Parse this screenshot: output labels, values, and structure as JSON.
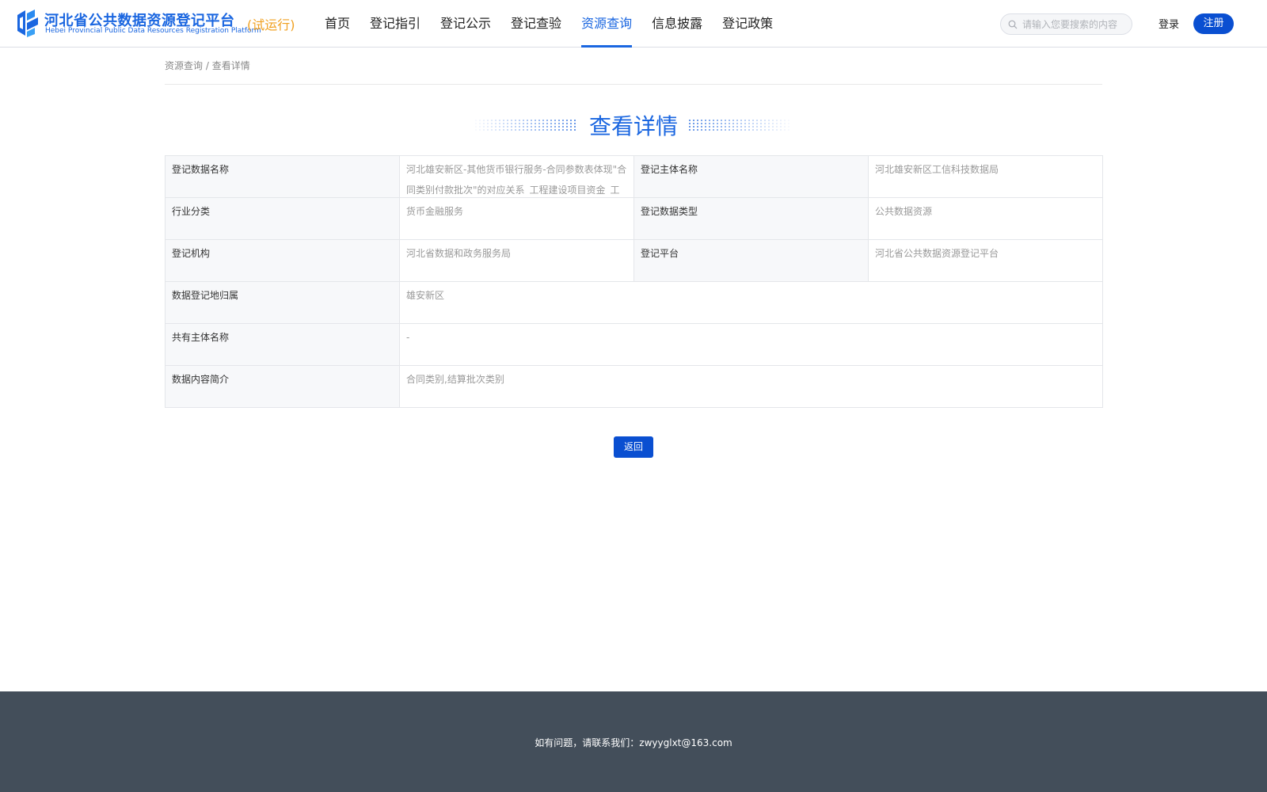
{
  "header": {
    "logo_cn": "河北省公共数据资源登记平台",
    "logo_en": "Hebei Provincial Public Data Resources Registration Platform",
    "logo_trial": "(试运行)",
    "nav": [
      {
        "label": "首页"
      },
      {
        "label": "登记指引"
      },
      {
        "label": "登记公示"
      },
      {
        "label": "登记查验"
      },
      {
        "label": "资源查询",
        "active": true
      },
      {
        "label": "信息披露"
      },
      {
        "label": "登记政策"
      }
    ],
    "search_placeholder": "请输入您要搜索的内容",
    "login_label": "登录",
    "register_label": "注册",
    "accent_color": "#1a66e0",
    "button_color": "#0a4fd1"
  },
  "breadcrumb": {
    "parent": "资源查询",
    "separator": " / ",
    "current": "查看详情"
  },
  "page_title": "查看详情",
  "details": {
    "data_name_label": "登记数据名称",
    "data_name_value": "河北雄安新区-其他货币银行服务-合同参数表体现\"合同类别付款批次\"的对应关系_工程建设项目资金_工行",
    "subject_name_label": "登记主体名称",
    "subject_name_value": "河北雄安新区工信科技数据局",
    "industry_label": "行业分类",
    "industry_value": "货币金融服务",
    "data_type_label": "登记数据类型",
    "data_type_value": "公共数据资源",
    "agency_label": "登记机构",
    "agency_value": "河北省数据和政务服务局",
    "platform_label": "登记平台",
    "platform_value": "河北省公共数据资源登记平台",
    "location_label": "数据登记地归属",
    "location_value": "雄安新区",
    "co_owner_label": "共有主体名称",
    "co_owner_value": "-",
    "summary_label": "数据内容简介",
    "summary_value": "合同类别,结算批次类别"
  },
  "return_label": "返回",
  "footer": {
    "contact_prefix": "如有问题，请联系我们：",
    "email": "zwyyglxt@163.com",
    "background_color": "#434e5a"
  }
}
